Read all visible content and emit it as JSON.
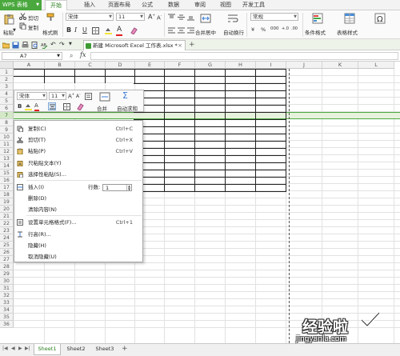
{
  "app": {
    "logo_label": "WPS 表格",
    "menu_tabs": [
      "开始",
      "插入",
      "页面布局",
      "公式",
      "数据",
      "审阅",
      "视图",
      "开发工具"
    ]
  },
  "ribbon": {
    "cut": "剪切",
    "copy": "复制",
    "format_painter": "格式刷",
    "paste": "粘贴",
    "font_name": "宋体",
    "font_size": "11",
    "merge_center": "合并居中",
    "wrap_text": "自动换行",
    "number_format": "常规",
    "cond_format": "条件格式",
    "table_style": "表格样式",
    "percent": "%",
    "comma": "000"
  },
  "doc_tab": {
    "title": "新建 Microsoft Excel 工作表.xlsx *"
  },
  "formula_bar": {
    "cell_ref": "A7",
    "fx": "fx"
  },
  "grid": {
    "columns": [
      "A",
      "B",
      "C",
      "D",
      "E",
      "F",
      "G",
      "H",
      "I",
      "J",
      "K",
      "L"
    ],
    "rows": [
      "1",
      "2",
      "3",
      "4",
      "5",
      "6",
      "7",
      "8",
      "9",
      "10",
      "11",
      "12",
      "13",
      "14",
      "15",
      "16",
      "17",
      "18",
      "19",
      "20",
      "21",
      "22",
      "23",
      "24",
      "25",
      "26",
      "27",
      "28",
      "29",
      "30",
      "31",
      "32",
      "33",
      "34",
      "35",
      "36"
    ],
    "selected_row": "7",
    "colors": {
      "accent": "#4aa83e",
      "selected": "#e6f2dc",
      "header_sel": "#d4e8c8"
    }
  },
  "mini_toolbar": {
    "font": "宋体",
    "size": "11",
    "merge": "合并",
    "autosum": "自动求和"
  },
  "context_menu": {
    "items": [
      {
        "label": "复制(C)",
        "shortcut": "Ctrl+C",
        "icon": "copy-icon"
      },
      {
        "label": "剪切(T)",
        "shortcut": "Ctrl+X",
        "icon": "scissors-icon"
      },
      {
        "label": "粘贴(P)",
        "shortcut": "Ctrl+V",
        "icon": "paste-icon"
      },
      {
        "label": "只粘贴文本(Y)",
        "shortcut": "",
        "icon": "paste-text-icon"
      },
      {
        "label": "选择性粘贴(S)...",
        "shortcut": "",
        "icon": "paste-special-icon"
      },
      {
        "label": "插入(I)",
        "shortcut": "",
        "icon": "insert-icon"
      },
      {
        "label": "删除(D)",
        "shortcut": "",
        "icon": ""
      },
      {
        "label": "清除内容(N)",
        "shortcut": "",
        "icon": ""
      },
      {
        "label": "设置单元格格式(F)...",
        "shortcut": "Ctrl+1",
        "icon": "format-cells-icon"
      },
      {
        "label": "行高(R)...",
        "shortcut": "",
        "icon": "row-height-icon"
      },
      {
        "label": "隐藏(H)",
        "shortcut": "",
        "icon": ""
      },
      {
        "label": "取消隐藏(U)",
        "shortcut": "",
        "icon": ""
      }
    ],
    "rows_label": "行数:",
    "rows_value": "1"
  },
  "sheets": {
    "tabs": [
      "Sheet1",
      "Sheet2",
      "Sheet3"
    ],
    "active": "Sheet1"
  },
  "watermark": {
    "main": "经验啦",
    "sub": "jingyanla.com"
  }
}
